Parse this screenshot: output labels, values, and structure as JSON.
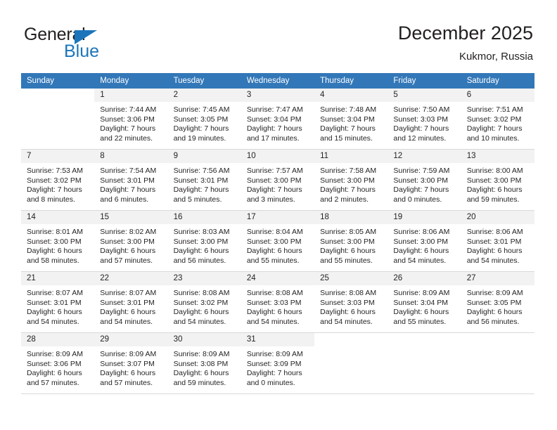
{
  "brand": {
    "name_top": "General",
    "name_bottom": "Blue",
    "mark": "triangle-logo",
    "accent_color": "#1b75bb"
  },
  "header": {
    "title": "December 2025",
    "subtitle": "Kukmor, Russia"
  },
  "theme": {
    "header_bg": "#3277b8",
    "header_text": "#ffffff",
    "daynum_bg": "#f2f2f2",
    "cell_bg": "#ffffff",
    "text": "#231f20",
    "grid_line": "#d9d9d9"
  },
  "calendar": {
    "weekday_headers": [
      "Sunday",
      "Monday",
      "Tuesday",
      "Wednesday",
      "Thursday",
      "Friday",
      "Saturday"
    ],
    "weeks": [
      [
        {
          "day": "",
          "lines": []
        },
        {
          "day": "1",
          "lines": [
            "Sunrise: 7:44 AM",
            "Sunset: 3:06 PM",
            "Daylight: 7 hours",
            "and 22 minutes."
          ]
        },
        {
          "day": "2",
          "lines": [
            "Sunrise: 7:45 AM",
            "Sunset: 3:05 PM",
            "Daylight: 7 hours",
            "and 19 minutes."
          ]
        },
        {
          "day": "3",
          "lines": [
            "Sunrise: 7:47 AM",
            "Sunset: 3:04 PM",
            "Daylight: 7 hours",
            "and 17 minutes."
          ]
        },
        {
          "day": "4",
          "lines": [
            "Sunrise: 7:48 AM",
            "Sunset: 3:04 PM",
            "Daylight: 7 hours",
            "and 15 minutes."
          ]
        },
        {
          "day": "5",
          "lines": [
            "Sunrise: 7:50 AM",
            "Sunset: 3:03 PM",
            "Daylight: 7 hours",
            "and 12 minutes."
          ]
        },
        {
          "day": "6",
          "lines": [
            "Sunrise: 7:51 AM",
            "Sunset: 3:02 PM",
            "Daylight: 7 hours",
            "and 10 minutes."
          ]
        }
      ],
      [
        {
          "day": "7",
          "lines": [
            "Sunrise: 7:53 AM",
            "Sunset: 3:02 PM",
            "Daylight: 7 hours",
            "and 8 minutes."
          ]
        },
        {
          "day": "8",
          "lines": [
            "Sunrise: 7:54 AM",
            "Sunset: 3:01 PM",
            "Daylight: 7 hours",
            "and 6 minutes."
          ]
        },
        {
          "day": "9",
          "lines": [
            "Sunrise: 7:56 AM",
            "Sunset: 3:01 PM",
            "Daylight: 7 hours",
            "and 5 minutes."
          ]
        },
        {
          "day": "10",
          "lines": [
            "Sunrise: 7:57 AM",
            "Sunset: 3:00 PM",
            "Daylight: 7 hours",
            "and 3 minutes."
          ]
        },
        {
          "day": "11",
          "lines": [
            "Sunrise: 7:58 AM",
            "Sunset: 3:00 PM",
            "Daylight: 7 hours",
            "and 2 minutes."
          ]
        },
        {
          "day": "12",
          "lines": [
            "Sunrise: 7:59 AM",
            "Sunset: 3:00 PM",
            "Daylight: 7 hours",
            "and 0 minutes."
          ]
        },
        {
          "day": "13",
          "lines": [
            "Sunrise: 8:00 AM",
            "Sunset: 3:00 PM",
            "Daylight: 6 hours",
            "and 59 minutes."
          ]
        }
      ],
      [
        {
          "day": "14",
          "lines": [
            "Sunrise: 8:01 AM",
            "Sunset: 3:00 PM",
            "Daylight: 6 hours",
            "and 58 minutes."
          ]
        },
        {
          "day": "15",
          "lines": [
            "Sunrise: 8:02 AM",
            "Sunset: 3:00 PM",
            "Daylight: 6 hours",
            "and 57 minutes."
          ]
        },
        {
          "day": "16",
          "lines": [
            "Sunrise: 8:03 AM",
            "Sunset: 3:00 PM",
            "Daylight: 6 hours",
            "and 56 minutes."
          ]
        },
        {
          "day": "17",
          "lines": [
            "Sunrise: 8:04 AM",
            "Sunset: 3:00 PM",
            "Daylight: 6 hours",
            "and 55 minutes."
          ]
        },
        {
          "day": "18",
          "lines": [
            "Sunrise: 8:05 AM",
            "Sunset: 3:00 PM",
            "Daylight: 6 hours",
            "and 55 minutes."
          ]
        },
        {
          "day": "19",
          "lines": [
            "Sunrise: 8:06 AM",
            "Sunset: 3:00 PM",
            "Daylight: 6 hours",
            "and 54 minutes."
          ]
        },
        {
          "day": "20",
          "lines": [
            "Sunrise: 8:06 AM",
            "Sunset: 3:01 PM",
            "Daylight: 6 hours",
            "and 54 minutes."
          ]
        }
      ],
      [
        {
          "day": "21",
          "lines": [
            "Sunrise: 8:07 AM",
            "Sunset: 3:01 PM",
            "Daylight: 6 hours",
            "and 54 minutes."
          ]
        },
        {
          "day": "22",
          "lines": [
            "Sunrise: 8:07 AM",
            "Sunset: 3:01 PM",
            "Daylight: 6 hours",
            "and 54 minutes."
          ]
        },
        {
          "day": "23",
          "lines": [
            "Sunrise: 8:08 AM",
            "Sunset: 3:02 PM",
            "Daylight: 6 hours",
            "and 54 minutes."
          ]
        },
        {
          "day": "24",
          "lines": [
            "Sunrise: 8:08 AM",
            "Sunset: 3:03 PM",
            "Daylight: 6 hours",
            "and 54 minutes."
          ]
        },
        {
          "day": "25",
          "lines": [
            "Sunrise: 8:08 AM",
            "Sunset: 3:03 PM",
            "Daylight: 6 hours",
            "and 54 minutes."
          ]
        },
        {
          "day": "26",
          "lines": [
            "Sunrise: 8:09 AM",
            "Sunset: 3:04 PM",
            "Daylight: 6 hours",
            "and 55 minutes."
          ]
        },
        {
          "day": "27",
          "lines": [
            "Sunrise: 8:09 AM",
            "Sunset: 3:05 PM",
            "Daylight: 6 hours",
            "and 56 minutes."
          ]
        }
      ],
      [
        {
          "day": "28",
          "lines": [
            "Sunrise: 8:09 AM",
            "Sunset: 3:06 PM",
            "Daylight: 6 hours",
            "and 57 minutes."
          ]
        },
        {
          "day": "29",
          "lines": [
            "Sunrise: 8:09 AM",
            "Sunset: 3:07 PM",
            "Daylight: 6 hours",
            "and 57 minutes."
          ]
        },
        {
          "day": "30",
          "lines": [
            "Sunrise: 8:09 AM",
            "Sunset: 3:08 PM",
            "Daylight: 6 hours",
            "and 59 minutes."
          ]
        },
        {
          "day": "31",
          "lines": [
            "Sunrise: 8:09 AM",
            "Sunset: 3:09 PM",
            "Daylight: 7 hours",
            "and 0 minutes."
          ]
        },
        {
          "day": "",
          "lines": []
        },
        {
          "day": "",
          "lines": []
        },
        {
          "day": "",
          "lines": []
        }
      ]
    ]
  }
}
